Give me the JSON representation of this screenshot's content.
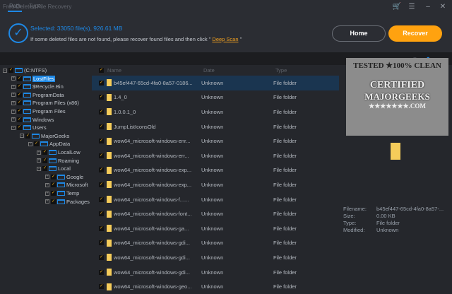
{
  "window": {
    "title": "Free Deleted File Recovery",
    "controls": [
      "cart",
      "menu",
      "minimize",
      "close"
    ]
  },
  "status": {
    "selected": "Selected: 33050 file(s), 926.61 MB",
    "hint_prefix": "If some deleted files are not found, please recover found files and then click \" ",
    "deep_scan": "Deep Scan",
    "hint_suffix": " \""
  },
  "buttons": {
    "home": "Home",
    "recover": "Recover"
  },
  "tabs": [
    "Path",
    "Type"
  ],
  "colors": {
    "accent": "#1e88e5",
    "recover": "#ffa20f",
    "folder": "#f5cc5a"
  },
  "tree": [
    {
      "label": "(C:NTFS)",
      "depth": 0,
      "exp": "-"
    },
    {
      "label": "LostFiles",
      "depth": 1,
      "exp": "+",
      "selected": true
    },
    {
      "label": "$Recycle.Bin",
      "depth": 1,
      "exp": "+"
    },
    {
      "label": "ProgramData",
      "depth": 1,
      "exp": "+"
    },
    {
      "label": "Program Files (x86)",
      "depth": 1,
      "exp": "+"
    },
    {
      "label": "Program Files",
      "depth": 1,
      "exp": "+"
    },
    {
      "label": "Windows",
      "depth": 1,
      "exp": "+"
    },
    {
      "label": "Users",
      "depth": 1,
      "exp": "-"
    },
    {
      "label": "MajorGeeks",
      "depth": 2,
      "exp": "-"
    },
    {
      "label": "AppData",
      "depth": 3,
      "exp": "-"
    },
    {
      "label": "LocalLow",
      "depth": 4,
      "exp": "+"
    },
    {
      "label": "Roaming",
      "depth": 4,
      "exp": "+"
    },
    {
      "label": "Local",
      "depth": 4,
      "exp": "-"
    },
    {
      "label": "Google",
      "depth": 5,
      "exp": "+"
    },
    {
      "label": "Microsoft",
      "depth": 5,
      "exp": "+"
    },
    {
      "label": "Temp",
      "depth": 5,
      "exp": "+"
    },
    {
      "label": "Packages",
      "depth": 5,
      "exp": "+"
    }
  ],
  "table": {
    "columns": {
      "name": "Name",
      "date": "Date",
      "type": "Type"
    },
    "rows": [
      {
        "name": "b45ef447-65cd-4fa0-8a57-0186...",
        "date": "Unknown",
        "type": "File folder"
      },
      {
        "name": "1.4_0",
        "date": "Unknown",
        "type": "File folder"
      },
      {
        "name": "1.0.0.1_0",
        "date": "Unknown",
        "type": "File folder"
      },
      {
        "name": "JumpListIconsOld",
        "date": "Unknown",
        "type": "File folder"
      },
      {
        "name": "wow64_microsoft-windows-enr...",
        "date": "Unknown",
        "type": "File folder"
      },
      {
        "name": "wow64_microsoft-windows-err...",
        "date": "Unknown",
        "type": "File folder"
      },
      {
        "name": "wow64_microsoft-windows-exp...",
        "date": "Unknown",
        "type": "File folder"
      },
      {
        "name": "wow64_microsoft-windows-exp...",
        "date": "Unknown",
        "type": "File folder"
      },
      {
        "name": "wow64_microsoft-windows-f......",
        "date": "Unknown",
        "type": "File folder"
      },
      {
        "name": "wow64_microsoft-windows-font...",
        "date": "Unknown",
        "type": "File folder"
      },
      {
        "name": "wow64_microsoft-windows-ga...",
        "date": "Unknown",
        "type": "File folder"
      },
      {
        "name": "wow64_microsoft-windows-gdi...",
        "date": "Unknown",
        "type": "File folder"
      },
      {
        "name": "wow64_microsoft-windows-gdi...",
        "date": "Unknown",
        "type": "File folder"
      },
      {
        "name": "wow64_microsoft-windows-gdi...",
        "date": "Unknown",
        "type": "File folder"
      },
      {
        "name": "wow64_microsoft-windows-geo...",
        "date": "Unknown",
        "type": "File folder"
      }
    ]
  },
  "badge": {
    "line1": "TESTED ★100% CLEAN",
    "line2": "CERTIFIED",
    "line3": "MAJORGEEKS",
    "line4": "★★★★★★★.COM"
  },
  "details": {
    "filename_label": "Filename:",
    "filename": "b45ef447-65cd-4fa0-8a57-...",
    "size_label": "Size:",
    "size": "0.00 KB",
    "type_label": "Type:",
    "type": "File folder",
    "modified_label": "Modified:",
    "modified": "Unknown"
  }
}
